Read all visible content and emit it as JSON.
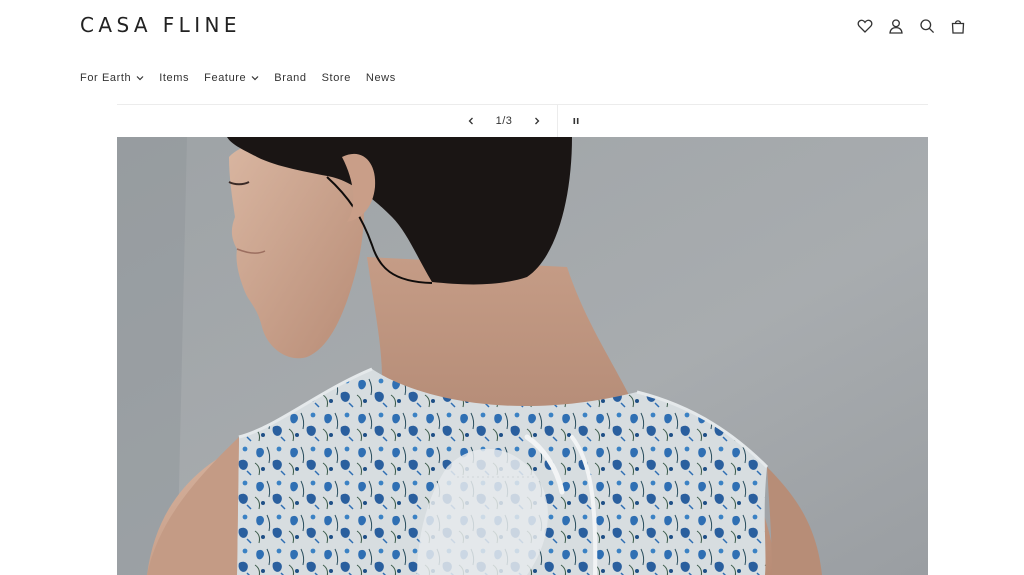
{
  "brand": {
    "logo_text": "CASA FLINE"
  },
  "header": {
    "icons": [
      "heart-icon",
      "account-icon",
      "search-icon",
      "cart-icon"
    ]
  },
  "nav": {
    "items": [
      {
        "label": "For Earth",
        "has_dropdown": true
      },
      {
        "label": "Items",
        "has_dropdown": false
      },
      {
        "label": "Feature",
        "has_dropdown": true
      },
      {
        "label": "Brand",
        "has_dropdown": false
      },
      {
        "label": "Store",
        "has_dropdown": false
      },
      {
        "label": "News",
        "has_dropdown": false
      }
    ]
  },
  "slideshow": {
    "counter": "1/3",
    "controls": [
      "chevron-left-icon",
      "chevron-right-icon",
      "pause-icon"
    ]
  },
  "colors": {
    "background": "#ffffff",
    "text": "#2b2b2b",
    "divider": "#ececec",
    "hero_wall": "#a4a8ab",
    "print_blue": "#2f6fb3"
  }
}
